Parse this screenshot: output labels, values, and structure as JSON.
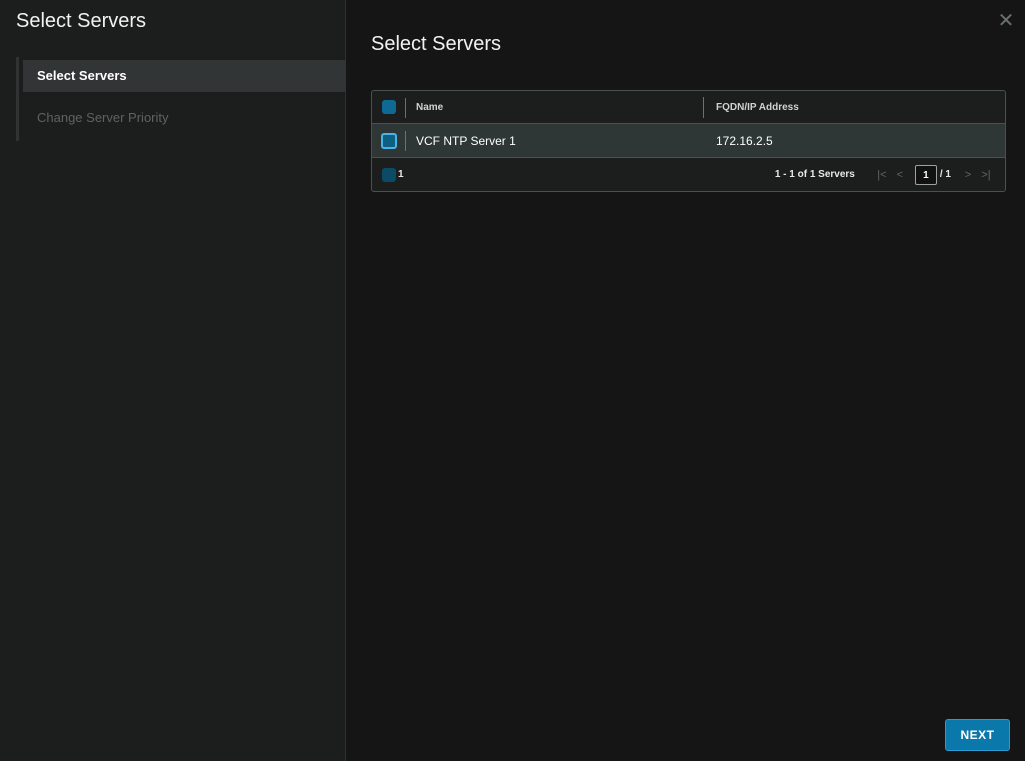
{
  "sidebar": {
    "title": "Select Servers",
    "steps": [
      {
        "label": "Select Servers",
        "state": "active"
      },
      {
        "label": "Change Server Priority",
        "state": "inactive"
      }
    ]
  },
  "main": {
    "title": "Select Servers",
    "close_icon": "close-icon",
    "grid": {
      "columns": [
        "Name",
        "FQDN/IP Address"
      ],
      "rows": [
        {
          "name": "VCF NTP Server 1",
          "address": "172.16.2.5",
          "selected": true
        }
      ],
      "footer": {
        "selected_count": "1",
        "description": "1 - 1 of 1 Servers",
        "current_page": "1",
        "total_pages": "/ 1"
      }
    },
    "next_label": "NEXT"
  },
  "colors": {
    "accent": "#0a78ab",
    "sidebar_bg": "#1b1e1d",
    "content_bg": "#151515",
    "selected_row": "#2f3636"
  }
}
